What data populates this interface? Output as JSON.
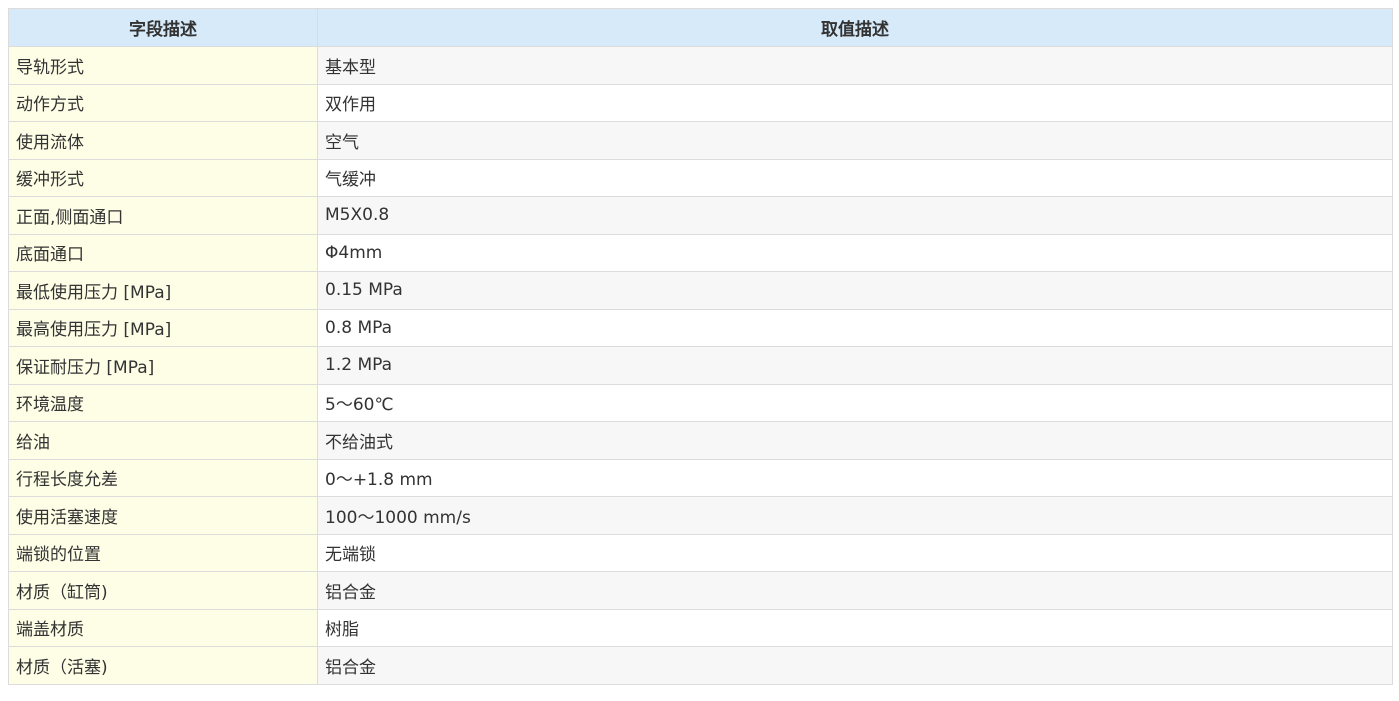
{
  "table": {
    "headers": {
      "field": "字段描述",
      "value": "取值描述"
    },
    "rows": [
      {
        "field": "导轨形式",
        "value": "基本型"
      },
      {
        "field": "动作方式",
        "value": "双作用"
      },
      {
        "field": "使用流体",
        "value": "空气"
      },
      {
        "field": "缓冲形式",
        "value": "气缓冲"
      },
      {
        "field": "正面,侧面通口",
        "value": "M5X0.8"
      },
      {
        "field": "底面通口",
        "value": "Φ4mm"
      },
      {
        "field": "最低使用压力 [MPa]",
        "value": "0.15 MPa"
      },
      {
        "field": "最高使用压力 [MPa]",
        "value": "0.8 MPa"
      },
      {
        "field": "保证耐压力 [MPa]",
        "value": "1.2 MPa"
      },
      {
        "field": "环境温度",
        "value": "5～60℃"
      },
      {
        "field": "给油",
        "value": "不给油式"
      },
      {
        "field": "行程长度允差",
        "value": "0～+1.8 mm"
      },
      {
        "field": "使用活塞速度",
        "value": "100～1000 mm/s"
      },
      {
        "field": "端锁的位置",
        "value": "无端锁"
      },
      {
        "field": "材质（缸筒)",
        "value": "铝合金"
      },
      {
        "field": "端盖材质",
        "value": "树脂"
      },
      {
        "field": "材质（活塞)",
        "value": "铝合金"
      }
    ]
  }
}
